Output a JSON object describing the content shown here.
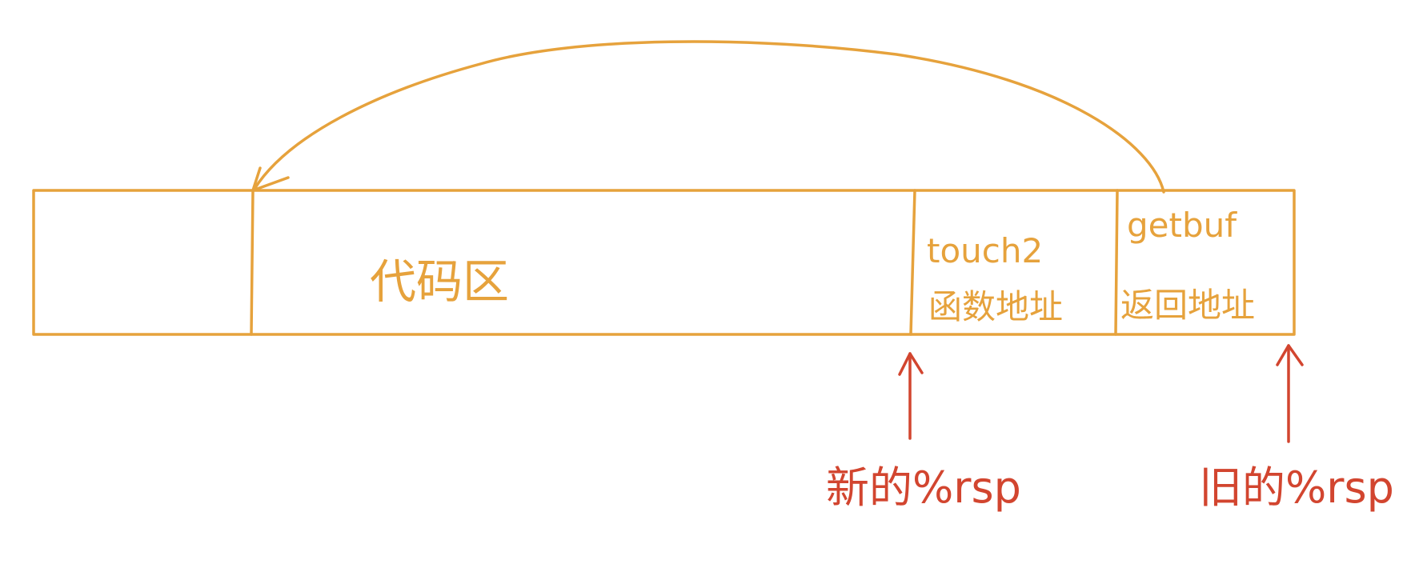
{
  "colors": {
    "memory_blocks": "#e6a23c",
    "rsp_pointers": "#d2452f",
    "background": "#ffffff"
  },
  "memory": {
    "code_area_label": "代码区",
    "touch2_line1": "touch2",
    "touch2_line2": "函数地址",
    "getbuf_line1": "getbuf",
    "getbuf_line2": "返回地址"
  },
  "pointers": {
    "new_rsp": "新的%rsp",
    "old_rsp": "旧的%rsp"
  }
}
